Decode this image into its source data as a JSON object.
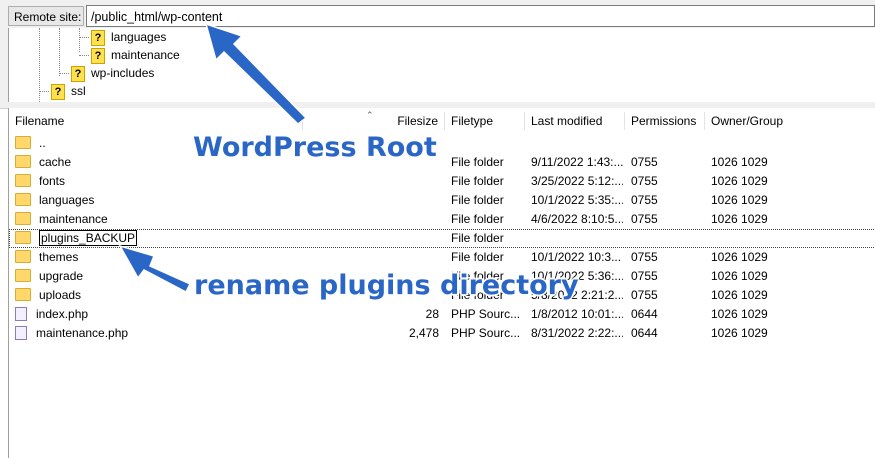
{
  "remote": {
    "label": "Remote site:",
    "path": "/public_html/wp-content"
  },
  "tree": [
    {
      "name": "languages"
    },
    {
      "name": "maintenance"
    },
    {
      "name": "wp-includes"
    },
    {
      "name": "ssl"
    }
  ],
  "columns": {
    "filename": "Filename",
    "filesize": "Filesize",
    "filetype": "Filetype",
    "modified": "Last modified",
    "permissions": "Permissions",
    "owner": "Owner/Group"
  },
  "rows": [
    {
      "name": "..",
      "size": "",
      "type": "",
      "modified": "",
      "perm": "",
      "owner": ""
    },
    {
      "name": "cache",
      "size": "",
      "type": "File folder",
      "modified": "9/11/2022 1:43:...",
      "perm": "0755",
      "owner": "1026 1029"
    },
    {
      "name": "fonts",
      "size": "",
      "type": "File folder",
      "modified": "3/25/2022 5:12:...",
      "perm": "0755",
      "owner": "1026 1029"
    },
    {
      "name": "languages",
      "size": "",
      "type": "File folder",
      "modified": "10/1/2022 5:35:...",
      "perm": "0755",
      "owner": "1026 1029"
    },
    {
      "name": "maintenance",
      "size": "",
      "type": "File folder",
      "modified": "4/6/2022 8:10:5...",
      "perm": "0755",
      "owner": "1026 1029"
    },
    {
      "name": "plugins_BACKUP",
      "size": "",
      "type": "File folder",
      "modified": "",
      "perm": "",
      "owner": ""
    },
    {
      "name": "themes",
      "size": "",
      "type": "File folder",
      "modified": "10/1/2022 10:3...",
      "perm": "0755",
      "owner": "1026 1029"
    },
    {
      "name": "upgrade",
      "size": "",
      "type": "File folder",
      "modified": "10/1/2022 5:36:...",
      "perm": "0755",
      "owner": "1026 1029"
    },
    {
      "name": "uploads",
      "size": "",
      "type": "File folder",
      "modified": "5/8/2022 2:21:2...",
      "perm": "0755",
      "owner": "1026 1029"
    },
    {
      "name": "index.php",
      "size": "28",
      "type": "PHP Sourc...",
      "modified": "1/8/2012 10:01:...",
      "perm": "0644",
      "owner": "1026 1029"
    },
    {
      "name": "maintenance.php",
      "size": "2,478",
      "type": "PHP Sourc...",
      "modified": "8/31/2022 2:22:...",
      "perm": "0644",
      "owner": "1026 1029"
    }
  ],
  "annotations": {
    "root": "WordPress Root",
    "rename": "rename plugins directory"
  },
  "colors": {
    "annotation": "#2a66c6",
    "folder": "#ffd76a"
  },
  "icons": {
    "folder": "folder-icon",
    "php": "php-file-icon",
    "unknown": "question-icon",
    "sort": "sort-caret-icon"
  }
}
